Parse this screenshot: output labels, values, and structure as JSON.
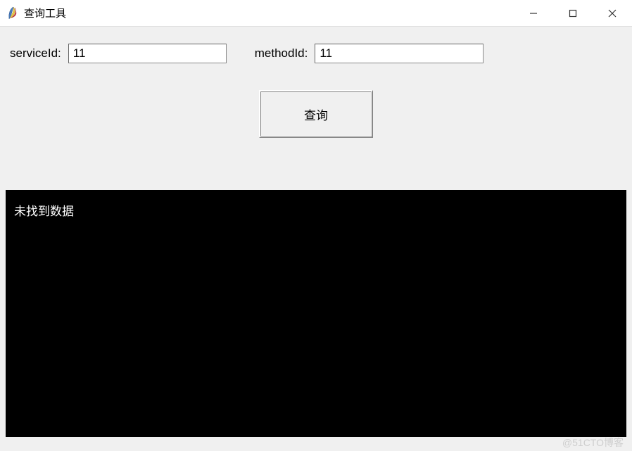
{
  "window": {
    "title": "查询工具",
    "controls": {
      "minimize": "—",
      "maximize": "□",
      "close": "✕"
    }
  },
  "form": {
    "serviceId": {
      "label": "serviceId:",
      "value": "11"
    },
    "methodId": {
      "label": "methodId:",
      "value": "11"
    }
  },
  "actions": {
    "query_label": "查询"
  },
  "result": {
    "message": "未找到数据"
  },
  "watermark": "@51CTO博客"
}
